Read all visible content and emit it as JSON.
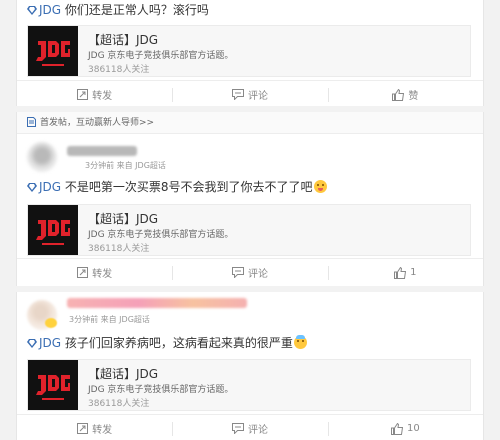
{
  "topic": {
    "name": "JDG",
    "title": "【超话】JDG",
    "description": "JDG 京东电子竞技俱乐部官方话题。",
    "followers": "386118人关注",
    "logo_alt_text": "JD GAMING"
  },
  "notice": {
    "text": "首发帖，互动赢新人导师>>"
  },
  "posts": [
    {
      "topic_tag": "JDG",
      "text": "你们还是正常人吗？滚行吗",
      "actions": {
        "repost": "转发",
        "comment": "评论",
        "like": "赞"
      }
    },
    {
      "meta": "3分钟前 来自 JDG超话",
      "topic_tag": "JDG",
      "text": "不是吧第一次买票8号不会我到了你去不了了吧",
      "actions": {
        "repost": "转发",
        "comment": "评论",
        "like": "1"
      }
    },
    {
      "meta": "3分钟前 来自 JDG超话",
      "topic_tag": "JDG",
      "text": "孩子们回家养病吧，这病看起来真的很严重",
      "actions": {
        "repost": "转发",
        "comment": "评论",
        "like": "10"
      }
    }
  ],
  "colors": {
    "link": "#3b6eb3",
    "logo_red": "#e0222b",
    "background": "#f2f2f2"
  }
}
